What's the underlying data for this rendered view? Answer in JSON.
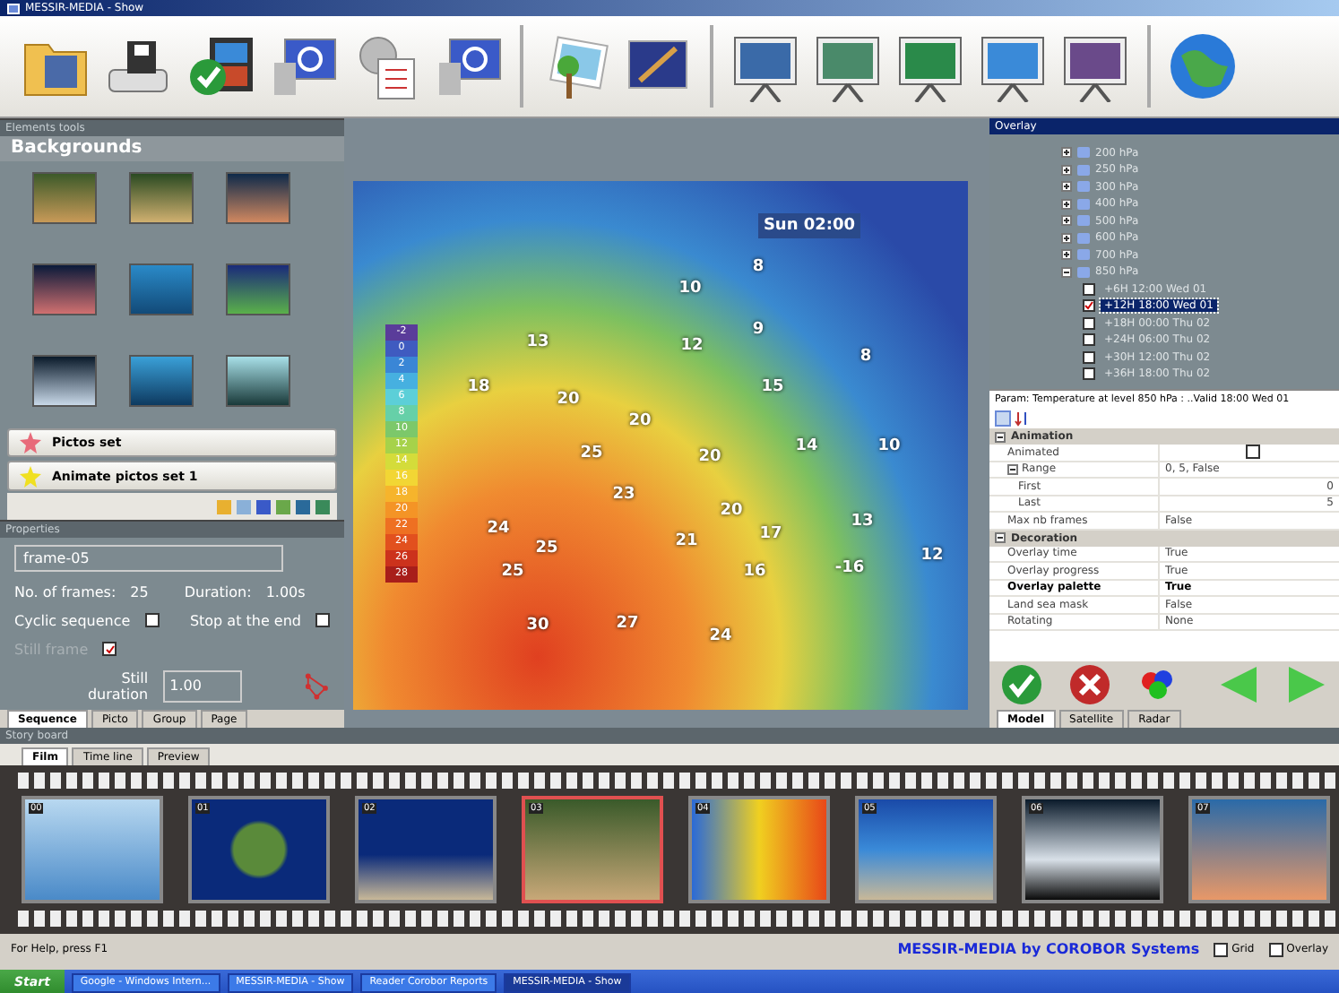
{
  "window": {
    "title": "MESSIR-MEDIA - Show"
  },
  "elements_panel": {
    "title": "Elements tools",
    "section": "Backgrounds",
    "list": [
      {
        "label": "Pictos set",
        "selected": false
      },
      {
        "label": "Animate pictos set 1",
        "selected": false
      }
    ]
  },
  "properties": {
    "title": "Properties",
    "name_value": "frame-05",
    "frames_label": "No. of frames:",
    "frames": "25",
    "duration_label": "Duration:",
    "duration": "1.00s",
    "options": [
      {
        "label": "Cyclic sequence",
        "checked": false,
        "disabled": false
      },
      {
        "label": "Stop at the end",
        "checked": false,
        "disabled": false
      },
      {
        "label": "Still frame",
        "checked": true,
        "disabled": true
      }
    ],
    "still_label": "Still duration",
    "still_value": "1.00",
    "tabs": [
      {
        "label": "Sequence",
        "selected": true
      },
      {
        "label": "Picto",
        "selected": false
      },
      {
        "label": "Group",
        "selected": false
      },
      {
        "label": "Page",
        "selected": false
      }
    ]
  },
  "map": {
    "time": "Sun 02:00",
    "legend": [
      "-2",
      "0",
      "2",
      "4",
      "6",
      "8",
      "10",
      "12",
      "14",
      "16",
      "18",
      "20",
      "22",
      "24",
      "26",
      "28"
    ],
    "temperatures": [
      "10",
      "8",
      "13",
      "12",
      "9",
      "8",
      "18",
      "20",
      "15",
      "20",
      "14",
      "10",
      "25",
      "20",
      "23",
      "20",
      "24",
      "25",
      "21",
      "17",
      "13",
      "16",
      "-16",
      "12",
      "25",
      "30",
      "27",
      "24"
    ]
  },
  "overlay": {
    "title": "Overlay",
    "tree": [
      {
        "label": "200 hPa",
        "expanded": false
      },
      {
        "label": "250 hPa",
        "expanded": false
      },
      {
        "label": "300 hPa",
        "expanded": false
      },
      {
        "label": "400 hPa",
        "expanded": false
      },
      {
        "label": "500 hPa",
        "expanded": false
      },
      {
        "label": "600 hPa",
        "expanded": false
      },
      {
        "label": "700 hPa",
        "expanded": false
      },
      {
        "label": "850 hPa",
        "expanded": true,
        "children": [
          {
            "label": "+6H 12:00  Wed 01",
            "checked": false,
            "selected": false
          },
          {
            "label": "+12H 18:00  Wed 01",
            "checked": true,
            "selected": true
          },
          {
            "label": "+18H 00:00  Thu 02",
            "checked": false,
            "selected": false
          },
          {
            "label": "+24H 06:00  Thu 02",
            "checked": false,
            "selected": false
          },
          {
            "label": "+30H 12:00  Thu 02",
            "checked": false,
            "selected": false
          },
          {
            "label": "+36H 18:00  Thu 02",
            "checked": false,
            "selected": false
          }
        ]
      }
    ],
    "param": "Param: Temperature at level 850 hPa : ..Valid 18:00 Wed 01",
    "grid": [
      {
        "label": "Animation",
        "expanded": true,
        "rows": [
          {
            "label": "Animated",
            "kind": "check",
            "checked": false,
            "modified": false
          },
          {
            "label": "Range",
            "kind": "text",
            "value": "0, 5, False",
            "modified": false,
            "expanded": true,
            "children": [
              {
                "label": "First",
                "kind": "number",
                "value": "0",
                "modified": false
              },
              {
                "label": "Last",
                "kind": "number",
                "value": "5",
                "modified": false
              }
            ]
          },
          {
            "label": "Max nb frames",
            "kind": "text",
            "value": "False",
            "modified": false
          }
        ]
      },
      {
        "label": "Decoration",
        "expanded": true,
        "rows": [
          {
            "label": "Overlay time",
            "kind": "text",
            "value": "True",
            "modified": false
          },
          {
            "label": "Overlay progress",
            "kind": "text",
            "value": "True",
            "modified": false
          },
          {
            "label": "Overlay palette",
            "kind": "text",
            "value": "True",
            "modified": true
          },
          {
            "label": "Land sea mask",
            "kind": "text",
            "value": "False",
            "modified": false
          },
          {
            "label": "Rotating",
            "kind": "text",
            "value": "None",
            "modified": false
          }
        ]
      }
    ],
    "tabs": [
      {
        "label": "Model",
        "selected": true
      },
      {
        "label": "Satellite",
        "selected": false
      },
      {
        "label": "Radar",
        "selected": false
      }
    ]
  },
  "storyboard": {
    "title": "Story board",
    "tabs": [
      {
        "label": "Film",
        "selected": true
      },
      {
        "label": "Time line",
        "selected": false
      },
      {
        "label": "Preview",
        "selected": false
      }
    ],
    "frames": [
      {
        "number": "00",
        "selected": false
      },
      {
        "number": "01",
        "selected": false
      },
      {
        "number": "02",
        "selected": false
      },
      {
        "number": "03",
        "selected": true
      },
      {
        "number": "04",
        "selected": false
      },
      {
        "number": "05",
        "selected": false
      },
      {
        "number": "06",
        "selected": false
      },
      {
        "number": "07",
        "selected": false
      }
    ]
  },
  "status_bar": {
    "help": "For Help, press F1",
    "brand": "MESSIR-MEDIA by COROBOR Systems",
    "options": [
      {
        "label": "Grid",
        "checked": false
      },
      {
        "label": "Overlay",
        "checked": false
      }
    ]
  },
  "taskbar": {
    "start": "Start",
    "tasks": [
      {
        "label": "Google - Windows Intern...",
        "selected": false
      },
      {
        "label": "MESSIR-MEDIA - Show",
        "selected": false
      },
      {
        "label": "Reader Corobor Reports",
        "selected": false
      },
      {
        "label": "MESSIR-MEDIA - Show",
        "selected": true
      }
    ]
  }
}
